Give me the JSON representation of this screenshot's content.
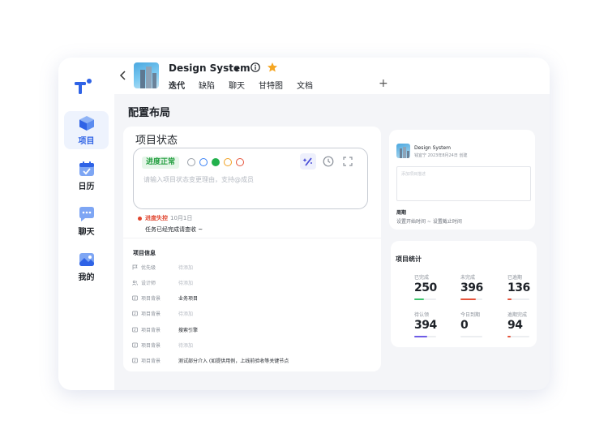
{
  "sidebar": {
    "items": [
      {
        "label": "项目",
        "active": true
      },
      {
        "label": "日历"
      },
      {
        "label": "聊天"
      },
      {
        "label": "我的"
      }
    ]
  },
  "header": {
    "project_name": "Design System",
    "tabs": [
      {
        "label": "迭代",
        "active": true
      },
      {
        "label": "缺陷"
      },
      {
        "label": "聊天"
      },
      {
        "label": "甘特图"
      },
      {
        "label": "文档"
      }
    ],
    "add_tab": "+"
  },
  "page_title": "配置布局",
  "status": {
    "title": "项目状态",
    "badge": "进度正常",
    "badge_color": "#27a043",
    "status_colors": [
      "#9aa0a8",
      "#3b82f6",
      "#22b14c",
      "#f0a020",
      "#e5533a"
    ],
    "input_placeholder": "请输入项目状态变更理由，支持@成员",
    "history": {
      "label": "进度失控",
      "date": "10月1日",
      "message": "任务已经完成请查收 ~"
    }
  },
  "info": {
    "title": "项目信息",
    "rows": [
      {
        "icon": "flag-icon",
        "key": "优先级",
        "value": "待添加",
        "placeholder": true
      },
      {
        "icon": "people-icon",
        "key": "设计师",
        "value": "待添加",
        "placeholder": true
      },
      {
        "icon": "tag-icon",
        "key": "项目背景",
        "value": "业务项目",
        "placeholder": false
      },
      {
        "icon": "tag-icon",
        "key": "项目背景",
        "value": "待添加",
        "placeholder": true
      },
      {
        "icon": "tag-icon",
        "key": "项目背景",
        "value": "搜索引擎",
        "placeholder": false
      },
      {
        "icon": "tag-icon",
        "key": "项目背景",
        "value": "待添加",
        "placeholder": true
      },
      {
        "icon": "tag-icon",
        "key": "项目背景",
        "value": "测试部分介入 (如提供用例，上线前验收等关键节点",
        "placeholder": false
      }
    ]
  },
  "detail": {
    "name": "Design System",
    "meta": "钱宜宁 2023年8月24日 创建",
    "desc_placeholder": "添加项目描述",
    "cycle_label": "周期",
    "cycle_value": "设置开始时间 ~ 设置截止时间"
  },
  "stats": {
    "title": "项目统计",
    "items": [
      {
        "label": "已完成",
        "value": "250",
        "color": "#3ec46d",
        "fraction": 0.45
      },
      {
        "label": "未完成",
        "value": "396",
        "color": "#e5533a",
        "fraction": 0.7
      },
      {
        "label": "已逾期",
        "value": "136",
        "color": "#e5533a",
        "fraction": 0.2
      },
      {
        "label": "待认领",
        "value": "394",
        "color": "#6e5ce6",
        "fraction": 0.6
      },
      {
        "label": "今日到期",
        "value": "0",
        "color": "#e5533a",
        "fraction": 0.0
      },
      {
        "label": "逾期完成",
        "value": "94",
        "color": "#e5533a",
        "fraction": 0.15
      }
    ]
  }
}
